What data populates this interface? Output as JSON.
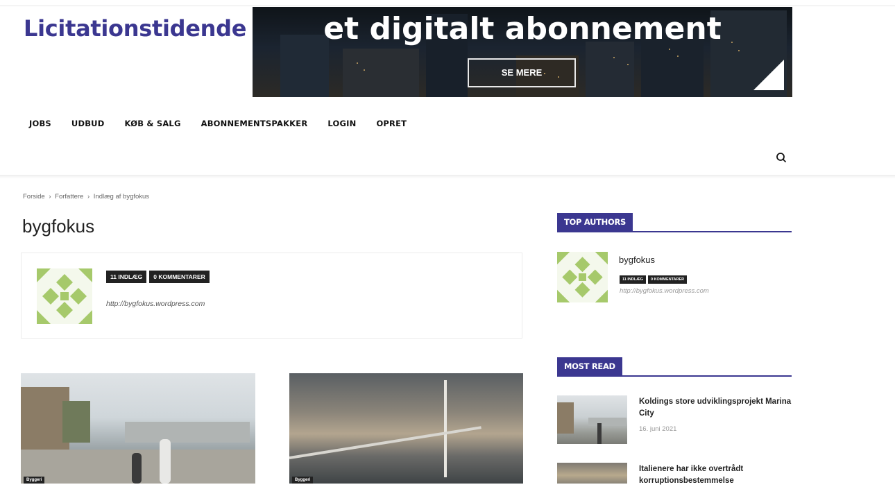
{
  "site": {
    "logo_text": "Licitationstidende",
    "brand_color": "#3b3790"
  },
  "banner": {
    "headline": "et digitalt abonnement",
    "button_label": "SE MERE"
  },
  "nav": {
    "items": [
      {
        "label": "JOBS"
      },
      {
        "label": "UDBUD"
      },
      {
        "label": "KØB & SALG"
      },
      {
        "label": "ABONNEMENTSPAKKER"
      },
      {
        "label": "LOGIN"
      },
      {
        "label": "OPRET"
      }
    ],
    "search_icon": "search-icon"
  },
  "breadcrumb": {
    "items": [
      "Forside",
      "Forfattere",
      "Indlæg af bygfokus"
    ],
    "separator": "›"
  },
  "page": {
    "title": "bygfokus"
  },
  "author_box": {
    "posts_badge": "11 INDLÆG",
    "comments_badge": "0 KOMMENTARER",
    "url": "http://bygfokus.wordpress.com"
  },
  "posts": [
    {
      "category": "Byggeri"
    },
    {
      "category": "Byggeri"
    }
  ],
  "sidebar": {
    "top_authors": {
      "heading": "TOP AUTHORS",
      "author": {
        "name": "bygfokus",
        "posts_badge": "11 INDLÆG",
        "comments_badge": "0 KOMMENTARER",
        "url": "http://bygfokus.wordpress.com"
      }
    },
    "most_read": {
      "heading": "MOST READ",
      "items": [
        {
          "title": "Koldings store udviklingsprojekt Marina City",
          "date": "16. juni 2021"
        },
        {
          "title": "Italienere har ikke overtrådt korruptionsbestemmelse",
          "date": ""
        }
      ]
    }
  }
}
